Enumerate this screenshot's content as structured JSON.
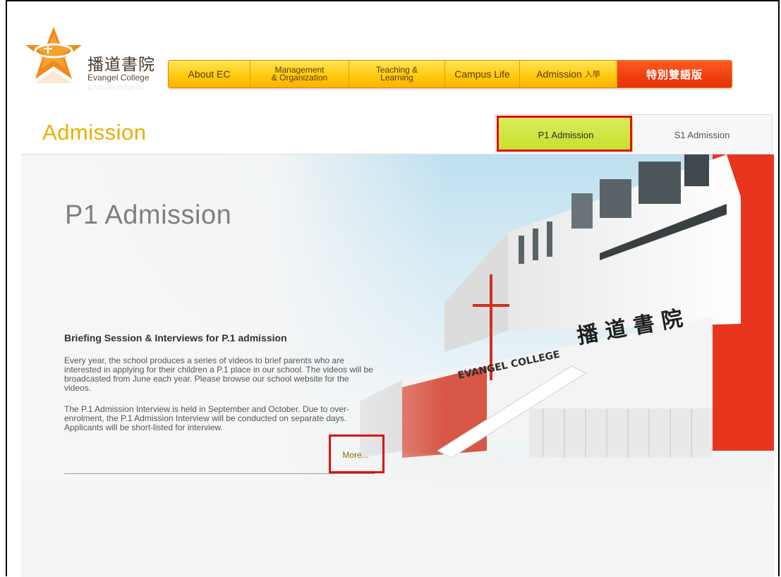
{
  "logo": {
    "cn": "播道書院",
    "en": "Evangel College",
    "en_reflection": "Evangel College"
  },
  "nav": {
    "about": "About EC",
    "management_l1": "Management",
    "management_l2": "& Organization",
    "teaching_l1": "Teaching &",
    "teaching_l2": "Learning",
    "campus": "Campus Life",
    "admission": "Admission",
    "admission_cn": "入學",
    "special": "特別雙語版"
  },
  "page_title": "Admission",
  "tabs": {
    "p1": "P1 Admission",
    "s1": "S1 Admission"
  },
  "hero": {
    "title": "P1 Admission",
    "building_sign_en": "EVANGEL COLLEGE",
    "building_sign_cn": "播 道 書 院"
  },
  "news": {
    "heading": "Briefing Session & Interviews for P.1 admission",
    "p1": "Every year, the school produces a series of videos to brief parents who are interested in applying for their children a P.1 place in our school. The videos will be broadcasted from June each year. Please browse our school website for the videos.",
    "p2": "The P.1 Admission Interview is held in September and October. Due to over-enrolment, the P.1 Admission Interview will be conducted on separate days. Applicants will be short-listed for interview.",
    "more": "More..."
  },
  "colors": {
    "accent_yellow": "#e6b000",
    "nav_orange": "#ffcc10",
    "special_red": "#f04010",
    "tab_green": "#c6df2a",
    "highlight_red": "#e01010"
  }
}
